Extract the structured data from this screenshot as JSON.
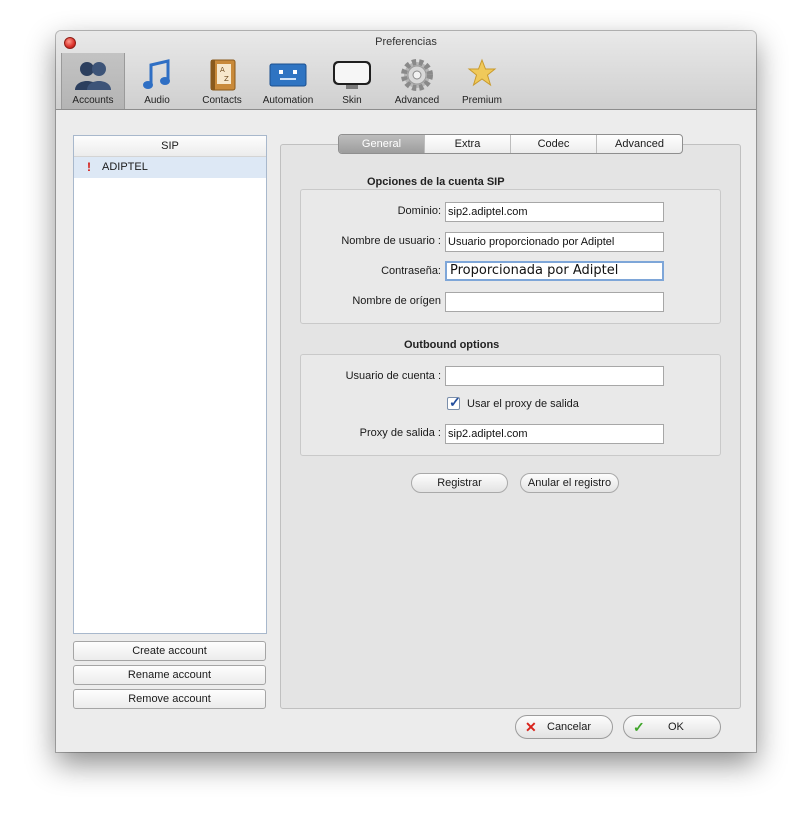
{
  "window": {
    "title": "Preferencias"
  },
  "toolbar": {
    "items": [
      {
        "label": "Accounts",
        "icon": "accounts-icon",
        "selected": true
      },
      {
        "label": "Audio",
        "icon": "music-note-icon"
      },
      {
        "label": "Contacts",
        "icon": "address-book-icon"
      },
      {
        "label": "Automation",
        "icon": "robot-icon"
      },
      {
        "label": "Skin",
        "icon": "monitor-icon"
      },
      {
        "label": "Advanced",
        "icon": "gear-icon"
      },
      {
        "label": "Premium",
        "icon": "star-icon"
      }
    ]
  },
  "accounts": {
    "header": "SIP",
    "items": [
      {
        "name": "ADIPTEL",
        "warning": "!"
      }
    ],
    "buttons": {
      "create": "Create account",
      "rename": "Rename account",
      "remove": "Remove account"
    }
  },
  "tabs": [
    "General",
    "Extra",
    "Codec",
    "Advanced"
  ],
  "sip_options": {
    "title": "Opciones de la cuenta SIP",
    "domain_label": "Dominio:",
    "domain_value": "sip2.adiptel.com",
    "username_label": "Nombre de usuario :",
    "username_value": "Usuario proporcionado por Adiptel",
    "password_label": "Contraseña:",
    "password_value": "Proporcionada por Adiptel",
    "origin_label": "Nombre de orígen",
    "origin_value": ""
  },
  "outbound": {
    "title": "Outbound options",
    "account_user_label": "Usuario de cuenta :",
    "account_user_value": "",
    "use_proxy_label": "Usar el proxy de salida",
    "use_proxy_checked": true,
    "proxy_label": "Proxy de salida :",
    "proxy_value": "sip2.adiptel.com"
  },
  "actions": {
    "register": "Registrar",
    "unregister": "Anular el registro"
  },
  "footer": {
    "cancel": "Cancelar",
    "ok": "OK"
  },
  "colors": {
    "close": "#d9302a",
    "cancel_icon": "#d9241c",
    "ok_icon": "#3fa52a",
    "selection": "#dde8f5"
  }
}
